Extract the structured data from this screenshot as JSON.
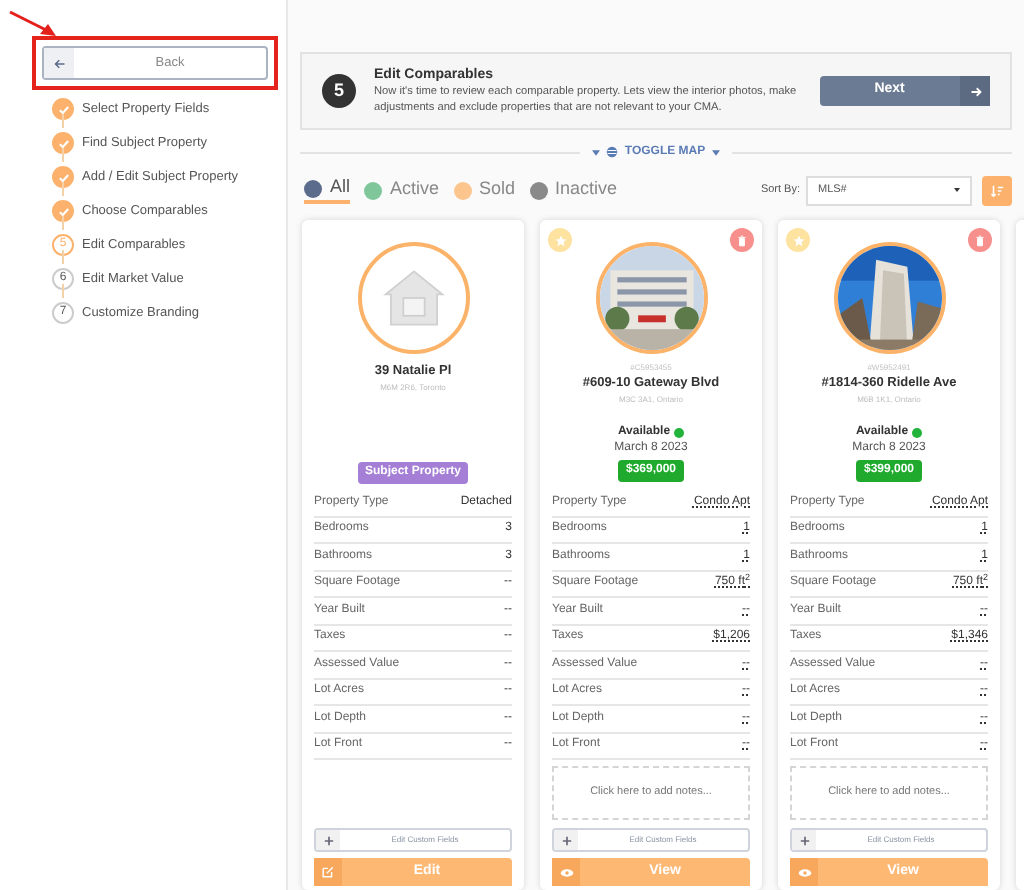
{
  "back_button": {
    "label": "Back"
  },
  "steps": [
    {
      "label": "Select Property Fields",
      "done": true,
      "current": false
    },
    {
      "label": "Find Subject Property",
      "done": true,
      "current": false
    },
    {
      "label": "Add / Edit Subject Property",
      "done": true,
      "current": false
    },
    {
      "label": "Choose Comparables",
      "done": true,
      "current": false
    },
    {
      "number": "5",
      "label": "Edit Comparables",
      "done": false,
      "current": true
    },
    {
      "number": "6",
      "label": "Edit Market Value",
      "done": false,
      "current": false
    },
    {
      "number": "7",
      "label": "Customize Branding",
      "done": false,
      "current": false
    }
  ],
  "header": {
    "step_number": "5",
    "title": "Edit Comparables",
    "description": "Now it's time to review each comparable property. Lets view the interior photos, make adjustments and exclude properties that are not relevant to your CMA.",
    "next_button": "Next"
  },
  "toggle_map": "TOGGLE MAP",
  "filters": [
    {
      "label": "All",
      "color": "#5b6b8c",
      "selected": true
    },
    {
      "label": "Active",
      "color": "#7fc79a",
      "selected": false
    },
    {
      "label": "Sold",
      "color": "#fcc58e",
      "selected": false
    },
    {
      "label": "Inactive",
      "color": "#8a8a8a",
      "selected": false
    }
  ],
  "sort": {
    "label": "Sort By:",
    "value": "MLS#"
  },
  "cards": [
    {
      "kind": "subject",
      "address": "39 Natalie Pl",
      "location": "M6M 2R6, Toronto",
      "badge": "Subject Property",
      "fields": [
        {
          "label": "Property Type",
          "value": "Detached"
        },
        {
          "label": "Bedrooms",
          "value": "3"
        },
        {
          "label": "Bathrooms",
          "value": "3"
        },
        {
          "label": "Square Footage",
          "value": "--"
        },
        {
          "label": "Year Built",
          "value": "--"
        },
        {
          "label": "Taxes",
          "value": "--"
        },
        {
          "label": "Assessed Value",
          "value": "--"
        },
        {
          "label": "Lot Acres",
          "value": "--"
        },
        {
          "label": "Lot Depth",
          "value": "--"
        },
        {
          "label": "Lot Front",
          "value": "--"
        }
      ],
      "custom_fields": "Edit Custom Fields",
      "action": "Edit"
    },
    {
      "kind": "comparable",
      "mls": "#C5953455",
      "address": "#609-10 Gateway Blvd",
      "location": "M3C 3A1, Ontario",
      "status": "Available",
      "color": "#22b33a",
      "date": "March 8 2023",
      "price": "$369,000",
      "fields": [
        {
          "label": "Property Type",
          "value": "Condo Apt"
        },
        {
          "label": "Bedrooms",
          "value": "1"
        },
        {
          "label": "Bathrooms",
          "value": "1"
        },
        {
          "label": "Square Footage",
          "value": "750 ft$^{2}$"
        },
        {
          "label": "Year Built",
          "value": "--"
        },
        {
          "label": "Taxes",
          "value": "$1,206"
        },
        {
          "label": "Assessed Value",
          "value": "--"
        },
        {
          "label": "Lot Acres",
          "value": "--"
        },
        {
          "label": "Lot Depth",
          "value": "--"
        },
        {
          "label": "Lot Front",
          "value": "--"
        }
      ],
      "notes": "Click here to add notes...",
      "custom_fields": "Edit Custom Fields",
      "action": "View"
    },
    {
      "kind": "comparable",
      "mls": "#W5952491",
      "address": "#1814-360 Ridelle Ave",
      "location": "M6B 1K1, Ontario",
      "status": "Available",
      "color": "#22b33a",
      "date": "March 8 2023",
      "price": "$399,000",
      "fields": [
        {
          "label": "Property Type",
          "value": "Condo Apt"
        },
        {
          "label": "Bedrooms",
          "value": "1"
        },
        {
          "label": "Bathrooms",
          "value": "1"
        },
        {
          "label": "Square Footage",
          "value": "750 ft$^{2}$"
        },
        {
          "label": "Year Built",
          "value": "--"
        },
        {
          "label": "Taxes",
          "value": "$1,346"
        },
        {
          "label": "Assessed Value",
          "value": "--"
        },
        {
          "label": "Lot Acres",
          "value": "--"
        },
        {
          "label": "Lot Depth",
          "value": "--"
        },
        {
          "label": "Lot Front",
          "value": "--"
        }
      ],
      "notes": "Click here to add notes...",
      "custom_fields": "Edit Custom Fields",
      "action": "View"
    }
  ]
}
